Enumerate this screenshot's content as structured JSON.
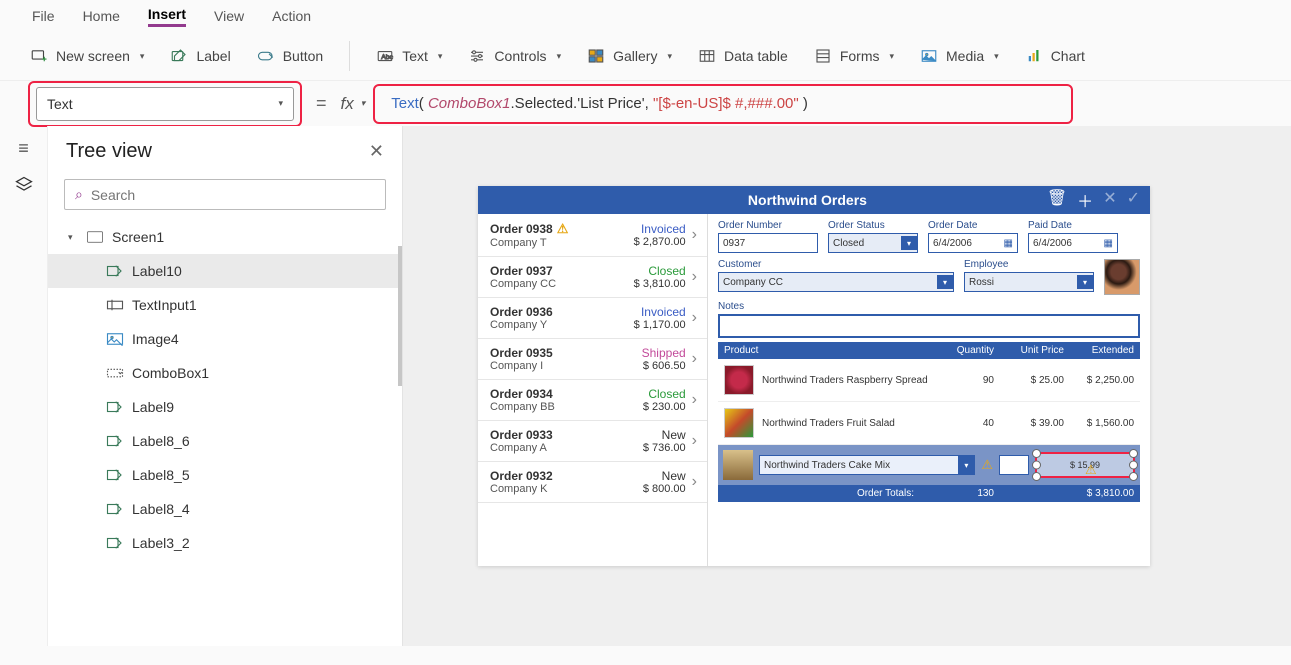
{
  "menubar": [
    "File",
    "Home",
    "Insert",
    "View",
    "Action"
  ],
  "menubar_active": 2,
  "ribbon": {
    "new_screen": "New screen",
    "label": "Label",
    "button": "Button",
    "text": "Text",
    "controls": "Controls",
    "gallery": "Gallery",
    "data_table": "Data table",
    "forms": "Forms",
    "media": "Media",
    "chart": "Chart"
  },
  "property_dropdown": "Text",
  "formula": {
    "fn": "Text",
    "open": "( ",
    "obj": "ComboBox1",
    "chain": ".Selected.'List Price', ",
    "str": "\"[$-en-US]$ #,###.00\"",
    "close": " )"
  },
  "tree": {
    "title": "Tree view",
    "search_placeholder": "Search",
    "root": "Screen1",
    "items": [
      "Label10",
      "TextInput1",
      "Image4",
      "ComboBox1",
      "Label9",
      "Label8_6",
      "Label8_5",
      "Label8_4",
      "Label3_2"
    ],
    "selected": 0
  },
  "app": {
    "title": "Northwind Orders",
    "orders": [
      {
        "num": "Order 0938",
        "warn": true,
        "company": "Company T",
        "status": "Invoiced",
        "status_cls": "invoiced",
        "amount": "$ 2,870.00"
      },
      {
        "num": "Order 0937",
        "company": "Company CC",
        "status": "Closed",
        "status_cls": "closed",
        "amount": "$ 3,810.00"
      },
      {
        "num": "Order 0936",
        "company": "Company Y",
        "status": "Invoiced",
        "status_cls": "invoiced",
        "amount": "$ 1,170.00"
      },
      {
        "num": "Order 0935",
        "company": "Company I",
        "status": "Shipped",
        "status_cls": "shipped",
        "amount": "$ 606.50"
      },
      {
        "num": "Order 0934",
        "company": "Company BB",
        "status": "Closed",
        "status_cls": "closed",
        "amount": "$ 230.00"
      },
      {
        "num": "Order 0933",
        "company": "Company A",
        "status": "New",
        "status_cls": "new",
        "amount": "$ 736.00"
      },
      {
        "num": "Order 0932",
        "company": "Company K",
        "status": "New",
        "status_cls": "new",
        "amount": "$ 800.00"
      }
    ],
    "fields": {
      "order_number_label": "Order Number",
      "order_number": "0937",
      "order_status_label": "Order Status",
      "order_status": "Closed",
      "order_date_label": "Order Date",
      "order_date": "6/4/2006",
      "paid_date_label": "Paid Date",
      "paid_date": "6/4/2006",
      "customer_label": "Customer",
      "customer": "Company CC",
      "employee_label": "Employee",
      "employee": "Rossi",
      "notes_label": "Notes"
    },
    "line_headers": {
      "product": "Product",
      "qty": "Quantity",
      "unit": "Unit Price",
      "ext": "Extended"
    },
    "lines": [
      {
        "name": "Northwind Traders Raspberry Spread",
        "qty": "90",
        "unit": "$ 25.00",
        "ext": "$ 2,250.00",
        "img": "r"
      },
      {
        "name": "Northwind Traders Fruit Salad",
        "qty": "40",
        "unit": "$ 39.00",
        "ext": "$ 1,560.00",
        "img": "f"
      }
    ],
    "newline": {
      "product": "Northwind Traders Cake Mix",
      "selected_price": "$ 15.99"
    },
    "totals": {
      "label": "Order Totals:",
      "qty": "130",
      "ext": "$ 3,810.00"
    }
  }
}
